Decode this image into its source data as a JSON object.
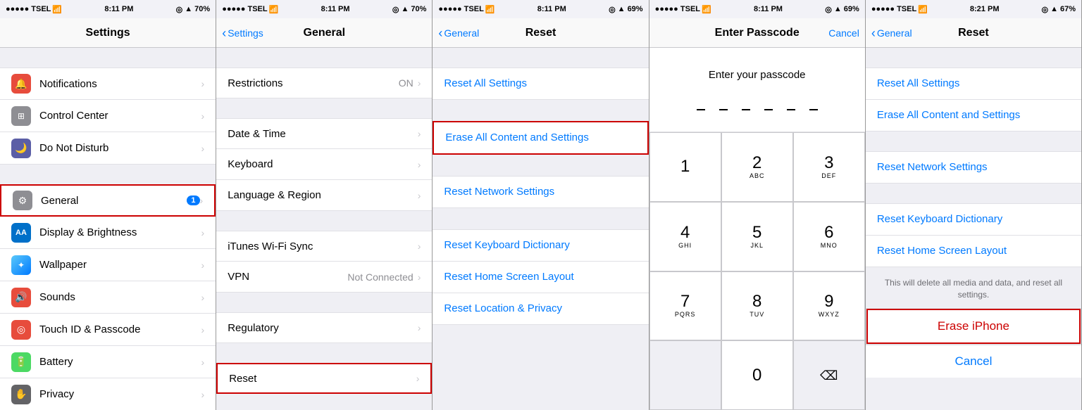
{
  "panels": [
    {
      "id": "settings",
      "status": {
        "carrier": "●●●●● TSEL",
        "wifi": "WiFi",
        "time": "8:11 PM",
        "location": "◎",
        "signal": "▲",
        "battery": "70%",
        "batteryIcon": "🔋"
      },
      "nav": {
        "title": "Settings",
        "back": null
      },
      "sections": [
        {
          "items": [
            {
              "id": "notifications",
              "icon": "🔔",
              "iconClass": "icon-notifications",
              "label": "Notifications",
              "value": "",
              "highlighted": false
            },
            {
              "id": "control-center",
              "icon": "⊞",
              "iconClass": "icon-control",
              "label": "Control Center",
              "value": "",
              "highlighted": false
            },
            {
              "id": "do-not-disturb",
              "icon": "🌙",
              "iconClass": "icon-dnd",
              "label": "Do Not Disturb",
              "value": "",
              "highlighted": false
            }
          ]
        },
        {
          "items": [
            {
              "id": "general",
              "icon": "⚙",
              "iconClass": "icon-general",
              "label": "General",
              "value": "",
              "badge": "1",
              "highlighted": true
            },
            {
              "id": "display-brightness",
              "icon": "AA",
              "iconClass": "icon-display",
              "label": "Display & Brightness",
              "value": "",
              "highlighted": false
            },
            {
              "id": "wallpaper",
              "icon": "✦",
              "iconClass": "icon-wallpaper",
              "label": "Wallpaper",
              "value": "",
              "highlighted": false
            },
            {
              "id": "sounds",
              "icon": "🔊",
              "iconClass": "icon-sounds",
              "label": "Sounds",
              "value": "",
              "highlighted": false
            },
            {
              "id": "touch-id",
              "icon": "◎",
              "iconClass": "icon-touchid",
              "label": "Touch ID & Passcode",
              "value": "",
              "highlighted": false
            },
            {
              "id": "battery",
              "icon": "🔋",
              "iconClass": "icon-battery",
              "label": "Battery",
              "value": "",
              "highlighted": false
            },
            {
              "id": "privacy",
              "icon": "✋",
              "iconClass": "icon-privacy",
              "label": "Privacy",
              "value": "",
              "highlighted": false
            }
          ]
        }
      ]
    },
    {
      "id": "general",
      "status": {
        "carrier": "●●●●● TSEL",
        "wifi": "WiFi",
        "time": "8:11 PM",
        "location": "◎",
        "signal": "▲",
        "battery": "70%",
        "batteryIcon": "🔋"
      },
      "nav": {
        "title": "General",
        "back": "Settings"
      },
      "items": [
        {
          "id": "restrictions",
          "label": "Restrictions",
          "value": "ON",
          "highlighted": false
        },
        {
          "id": "date-time",
          "label": "Date & Time",
          "value": "",
          "highlighted": false
        },
        {
          "id": "keyboard",
          "label": "Keyboard",
          "value": "",
          "highlighted": false
        },
        {
          "id": "language-region",
          "label": "Language & Region",
          "value": "",
          "highlighted": false
        },
        {
          "id": "itunes-wifi",
          "label": "iTunes Wi-Fi Sync",
          "value": "",
          "highlighted": false
        },
        {
          "id": "vpn",
          "label": "VPN",
          "value": "Not Connected",
          "highlighted": false
        },
        {
          "id": "regulatory",
          "label": "Regulatory",
          "value": "",
          "highlighted": false
        },
        {
          "id": "reset",
          "label": "Reset",
          "value": "",
          "highlighted": true
        }
      ]
    },
    {
      "id": "reset",
      "status": {
        "carrier": "●●●●● TSEL",
        "wifi": "WiFi",
        "time": "8:11 PM",
        "location": "◎",
        "signal": "▲",
        "battery": "69%",
        "batteryIcon": "🔋"
      },
      "nav": {
        "title": "Reset",
        "back": "General"
      },
      "items": [
        {
          "id": "reset-all-settings",
          "label": "Reset All Settings",
          "highlighted": false
        },
        {
          "id": "erase-all",
          "label": "Erase All Content and Settings",
          "highlighted": true
        },
        {
          "id": "reset-network",
          "label": "Reset Network Settings",
          "highlighted": false
        },
        {
          "id": "reset-keyboard",
          "label": "Reset Keyboard Dictionary",
          "highlighted": false
        },
        {
          "id": "reset-home",
          "label": "Reset Home Screen Layout",
          "highlighted": false
        },
        {
          "id": "reset-location",
          "label": "Reset Location & Privacy",
          "highlighted": false
        }
      ]
    },
    {
      "id": "passcode",
      "status": {
        "carrier": "●●●●● TSEL",
        "wifi": "WiFi",
        "time": "8:11 PM",
        "location": "◎",
        "signal": "▲",
        "battery": "69%",
        "batteryIcon": "🔋"
      },
      "nav": {
        "title": "Enter Passcode",
        "back": null,
        "cancel": "Cancel"
      },
      "prompt": "Enter your passcode",
      "numpad": [
        {
          "digit": "1",
          "letters": ""
        },
        {
          "digit": "2",
          "letters": "ABC"
        },
        {
          "digit": "3",
          "letters": "DEF"
        },
        {
          "digit": "4",
          "letters": "GHI"
        },
        {
          "digit": "5",
          "letters": "JKL"
        },
        {
          "digit": "6",
          "letters": "MNO"
        },
        {
          "digit": "7",
          "letters": "PQRS"
        },
        {
          "digit": "8",
          "letters": "TUV"
        },
        {
          "digit": "9",
          "letters": "WXYZ"
        },
        {
          "digit": "",
          "letters": ""
        },
        {
          "digit": "0",
          "letters": ""
        },
        {
          "digit": "⌫",
          "letters": ""
        }
      ]
    },
    {
      "id": "reset-confirm",
      "status": {
        "carrier": "●●●●● TSEL",
        "wifi": "WiFi",
        "time": "8:21 PM",
        "location": "◎",
        "signal": "▲",
        "battery": "67%",
        "batteryIcon": "🔋"
      },
      "nav": {
        "title": "Reset",
        "back": "General"
      },
      "items": [
        {
          "id": "reset-all-settings",
          "label": "Reset All Settings"
        },
        {
          "id": "erase-all",
          "label": "Erase All Content and Settings"
        },
        {
          "id": "reset-network",
          "label": "Reset Network Settings"
        },
        {
          "id": "reset-keyboard",
          "label": "Reset Keyboard Dictionary"
        },
        {
          "id": "reset-home",
          "label": "Reset Home Screen Layout"
        }
      ],
      "warning": "This will delete all media and data, and reset all settings.",
      "eraseLabel": "Erase iPhone",
      "cancelLabel": "Cancel"
    }
  ]
}
